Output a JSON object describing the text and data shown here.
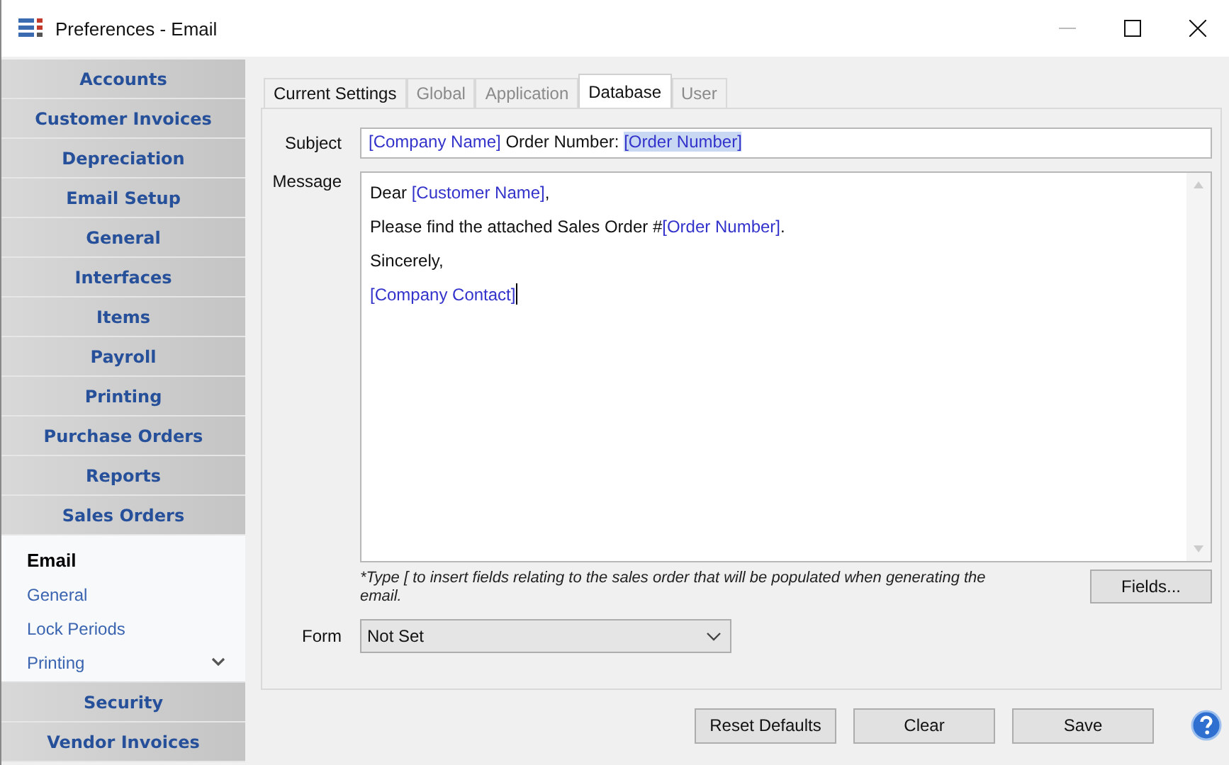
{
  "window": {
    "title": "Preferences - Email"
  },
  "sidebar": {
    "items_before": [
      {
        "label": "Accounts"
      },
      {
        "label": "Customer Invoices"
      },
      {
        "label": "Depreciation"
      },
      {
        "label": "Email Setup"
      },
      {
        "label": "General"
      },
      {
        "label": "Interfaces"
      },
      {
        "label": "Items"
      },
      {
        "label": "Payroll"
      },
      {
        "label": "Printing"
      },
      {
        "label": "Purchase Orders"
      },
      {
        "label": "Reports"
      },
      {
        "label": "Sales Orders",
        "expanded": true
      }
    ],
    "sub_items": [
      {
        "label": "Email",
        "selected": true
      },
      {
        "label": "General",
        "selected": false
      },
      {
        "label": "Lock Periods",
        "selected": false
      },
      {
        "label": "Printing",
        "selected": false
      }
    ],
    "items_after": [
      {
        "label": "Security"
      },
      {
        "label": "Vendor Invoices"
      }
    ]
  },
  "tabs": [
    {
      "label": "Current Settings",
      "selected": false,
      "disabled": false
    },
    {
      "label": "Global",
      "selected": false,
      "disabled": true
    },
    {
      "label": "Application",
      "selected": false,
      "disabled": true
    },
    {
      "label": "Database",
      "selected": true,
      "disabled": false
    },
    {
      "label": "User",
      "selected": false,
      "disabled": true
    }
  ],
  "subject": {
    "label": "Subject",
    "segments": [
      {
        "text": "[Company Name]",
        "kind": "field",
        "selected": false
      },
      {
        "text": " Order Number: ",
        "kind": "text",
        "selected": false
      },
      {
        "text": "[Order Number]",
        "kind": "field",
        "selected": true
      }
    ]
  },
  "message": {
    "label": "Message",
    "lines": [
      {
        "caret": false,
        "segments": [
          {
            "text": "Dear ",
            "kind": "text"
          },
          {
            "text": "[Customer Name]",
            "kind": "field"
          },
          {
            "text": ",",
            "kind": "text"
          }
        ]
      },
      {
        "caret": false,
        "segments": [
          {
            "text": "Please find the attached Sales Order #",
            "kind": "text"
          },
          {
            "text": "[Order Number]",
            "kind": "field"
          },
          {
            "text": ".",
            "kind": "text"
          }
        ]
      },
      {
        "caret": false,
        "segments": [
          {
            "text": "Sincerely,",
            "kind": "text"
          }
        ]
      },
      {
        "caret": true,
        "segments": [
          {
            "text": "[Company Contact]",
            "kind": "field"
          }
        ]
      }
    ]
  },
  "hint": "*Type [  to insert fields relating to the sales order that will be populated when generating the email.",
  "fields_button": "Fields...",
  "form": {
    "label": "Form",
    "value": "Not Set"
  },
  "buttons": [
    "Reset Defaults",
    "Clear",
    "Save"
  ]
}
